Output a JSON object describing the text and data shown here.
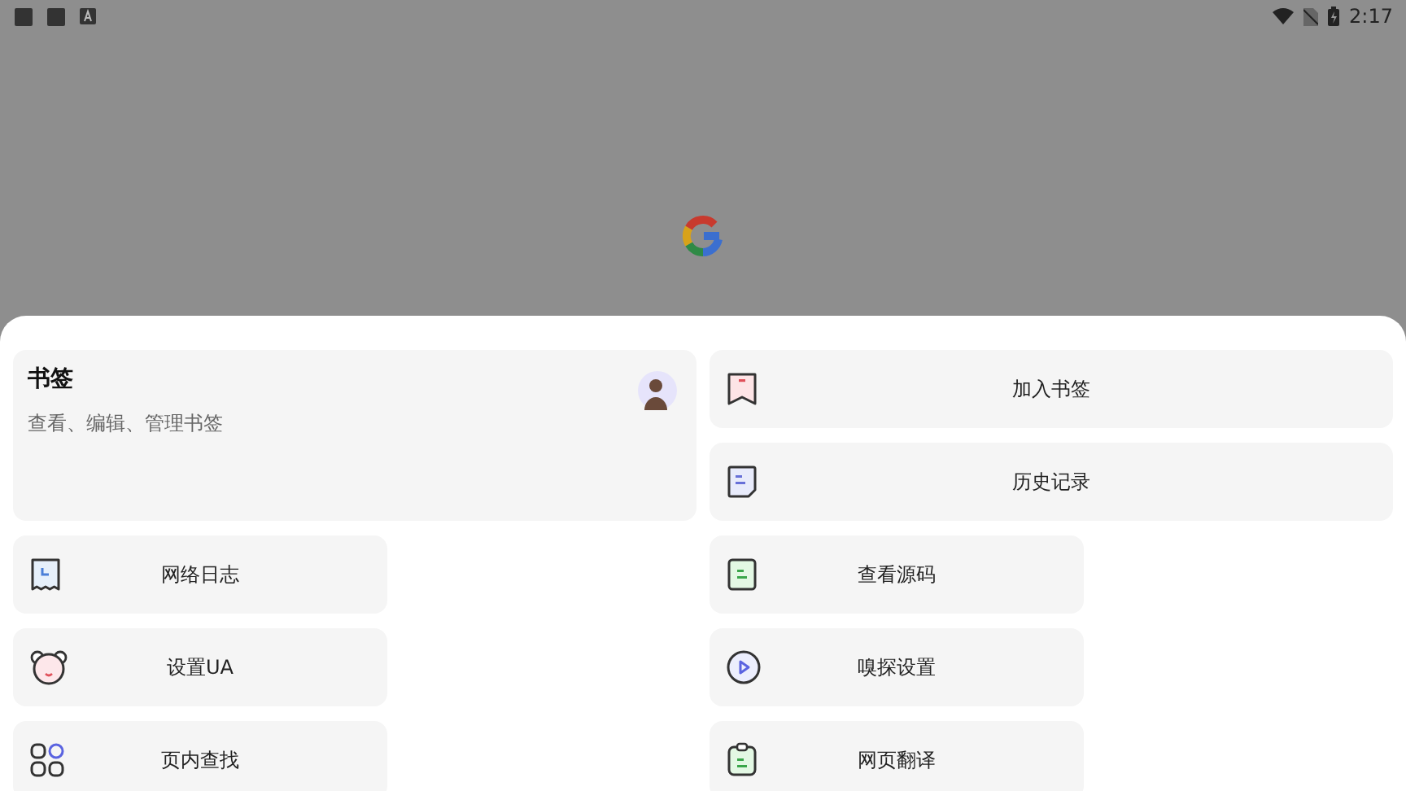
{
  "status_bar": {
    "time": "2:17"
  },
  "bookmarks_card": {
    "title": "书签",
    "subtitle": "查看、编辑、管理书签"
  },
  "side_actions": [
    {
      "label": "加入书签",
      "kind": "bookmark"
    },
    {
      "label": "历史记录",
      "kind": "history"
    }
  ],
  "actions": [
    {
      "label": "网络日志",
      "kind": "log"
    },
    {
      "label": "查看源码",
      "kind": "source"
    },
    {
      "label": "设置UA",
      "kind": "ua"
    },
    {
      "label": "嗅探设置",
      "kind": "sniff"
    },
    {
      "label": "页内查找",
      "kind": "find"
    },
    {
      "label": "网页翻译",
      "kind": "translate"
    }
  ]
}
